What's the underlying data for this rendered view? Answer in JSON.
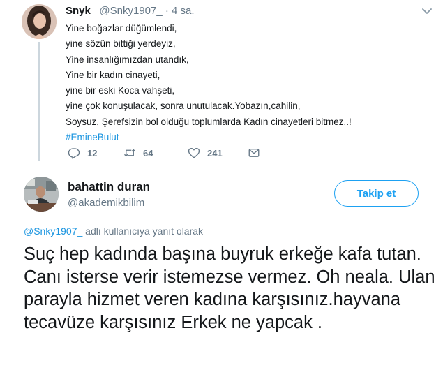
{
  "tweet1": {
    "display_name": "Snyk_",
    "handle": "@Snky1907_",
    "separator": "·",
    "time": "4 sa.",
    "lines": [
      "Yine boğazlar düğümlendi,",
      "yine sözün bittiği yerdeyiz,",
      "Yine insanlığımızdan utandık,",
      "Yine bir kadın cinayeti,",
      "yine bir eski Koca vahşeti,",
      "yine çok konuşulacak, sonra unutulacak.Yobazın,cahilin,",
      "Soysuz, Şerefsizin bol olduğu toplumlarda Kadın cinayetleri bitmez..!"
    ],
    "hashtag": "#EmineBulut",
    "actions": {
      "reply_icon": "reply-icon",
      "reply_count": "12",
      "retweet_icon": "retweet-icon",
      "retweet_count": "64",
      "like_icon": "heart-icon",
      "like_count": "241",
      "dm_icon": "envelope-icon"
    }
  },
  "tweet2": {
    "display_name": "bahattin duran",
    "handle": "@akademikbilim",
    "follow_label": "Takip et",
    "reply_mention": "@Snky1907_",
    "reply_suffix": " adlı kullanıcıya yanıt olarak",
    "text": "Suç hep kadında başına buyruk erkeğe kafa tutan. Canı isterse verir istemezse vermez. Oh neala. Ulan parayla hizmet veren kadına karşısınız.hayvana tecavüze karşısınız Erkek ne yapcak ."
  },
  "colors": {
    "accent": "#1da1f2",
    "link": "#1b95e0",
    "muted": "#657786",
    "text": "#14171a",
    "thread_line": "#ccd6dd"
  }
}
